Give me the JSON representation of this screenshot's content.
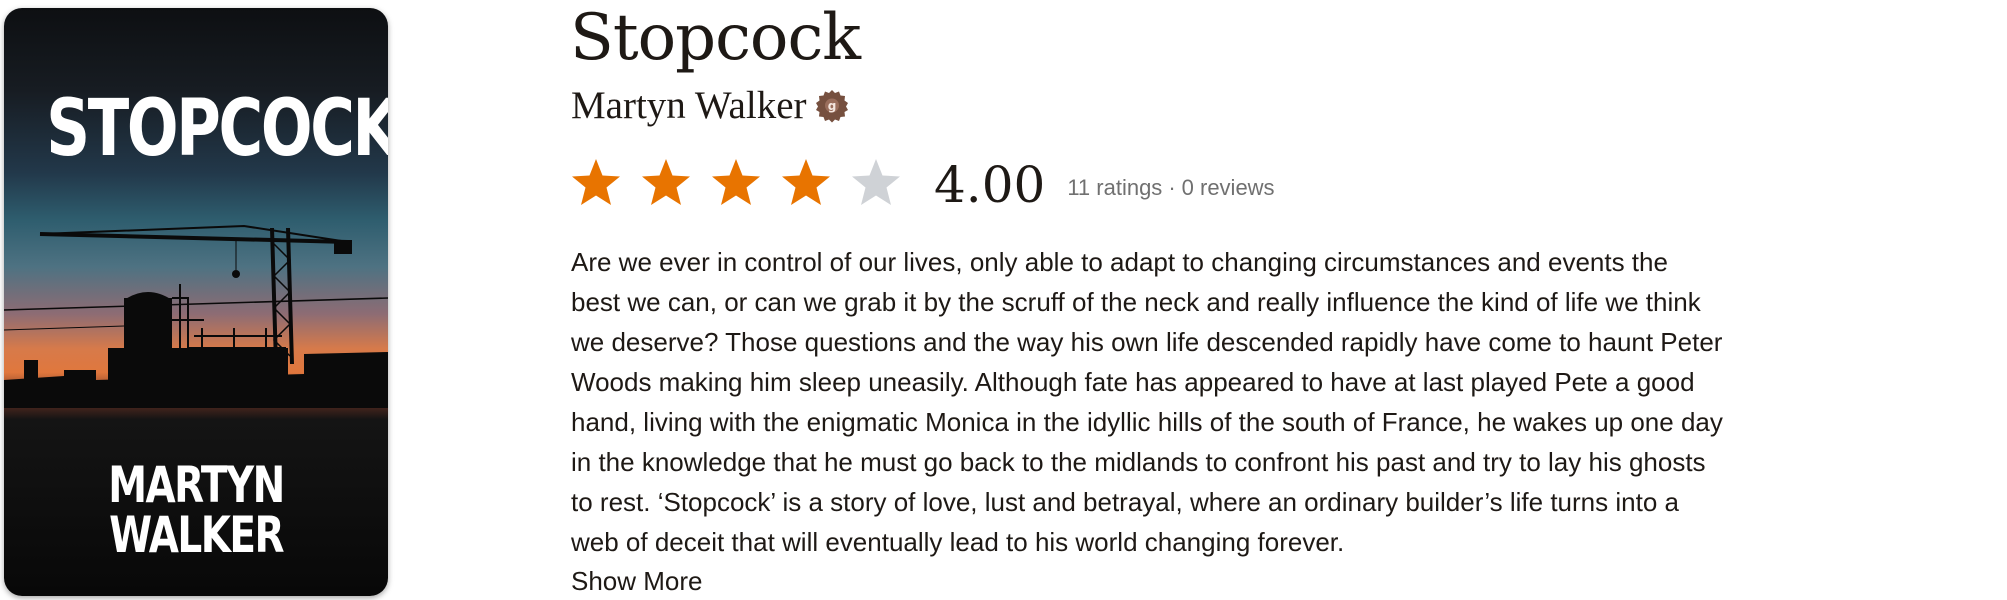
{
  "cover": {
    "title_text": "STOPCOCK",
    "author_text": "MARTYN WALKER"
  },
  "book": {
    "title": "Stopcock",
    "author": "Martyn Walker",
    "author_badge_icon": "goodreads-author-badge-icon"
  },
  "rating": {
    "value": "4.00",
    "stars_filled": 4,
    "stars_total": 5,
    "ratings_count": "11 ratings",
    "separator": "·",
    "reviews_count": "0 reviews",
    "star_color": "#e87400",
    "star_empty_color": "#cfd2d6"
  },
  "description": {
    "lines": [
      "Are we ever in control of our lives, only able to adapt to changing circumstances and events the",
      "best we can, or can we grab it by the scruff of the neck and really influence the kind of life we think",
      "we deserve? Those questions and the way his own life descended rapidly have come to haunt Peter",
      "Woods making him sleep uneasily. Although fate has appeared to have at last played Pete a good",
      "hand, living with the enigmatic Monica in the idyllic hills of the south of France, he wakes up one day",
      "in the knowledge that he must go back to the midlands to confront his past and try to lay his ghosts",
      "to rest. ‘Stopcock’ is a story of love, lust and betrayal, where an ordinary builder’s life turns into a",
      "web of deceit that will eventually lead to his world changing forever."
    ],
    "show_more_label": "Show More"
  }
}
